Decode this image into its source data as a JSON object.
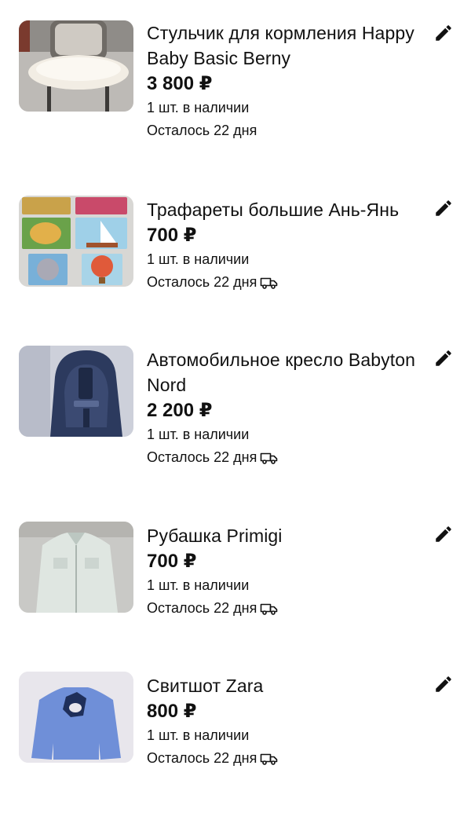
{
  "listings": [
    {
      "title": "Стульчик для кормления Happy Baby Basic Berny",
      "price": "3 800 ₽",
      "stock": "1 шт. в наличии",
      "remaining": "Осталось 22 дня",
      "delivery": false,
      "image_icon": "high-chair-photo"
    },
    {
      "title": "Трафареты большие Ань-Янь",
      "price": "700 ₽",
      "stock": "1 шт. в наличии",
      "remaining": "Осталось 22 дня",
      "delivery": true,
      "image_icon": "stencil-puzzles-photo"
    },
    {
      "title": "Автомобильное кресло Babyton Nord",
      "price": "2 200 ₽",
      "stock": "1 шт. в наличии",
      "remaining": "Осталось 22 дня",
      "delivery": true,
      "image_icon": "car-seat-photo"
    },
    {
      "title": "Рубашка Primigi",
      "price": "700 ₽",
      "stock": "1 шт. в наличии",
      "remaining": "Осталось 22 дня",
      "delivery": true,
      "image_icon": "shirt-photo"
    },
    {
      "title": "Свитшот Zara",
      "price": "800 ₽",
      "stock": "1 шт. в наличии",
      "remaining": "Осталось 22 дня",
      "delivery": true,
      "image_icon": "sweatshirt-photo"
    }
  ],
  "icons": {
    "edit": "pencil-icon",
    "delivery": "truck-icon"
  },
  "colors": {
    "text": "#111111",
    "background": "#ffffff"
  }
}
